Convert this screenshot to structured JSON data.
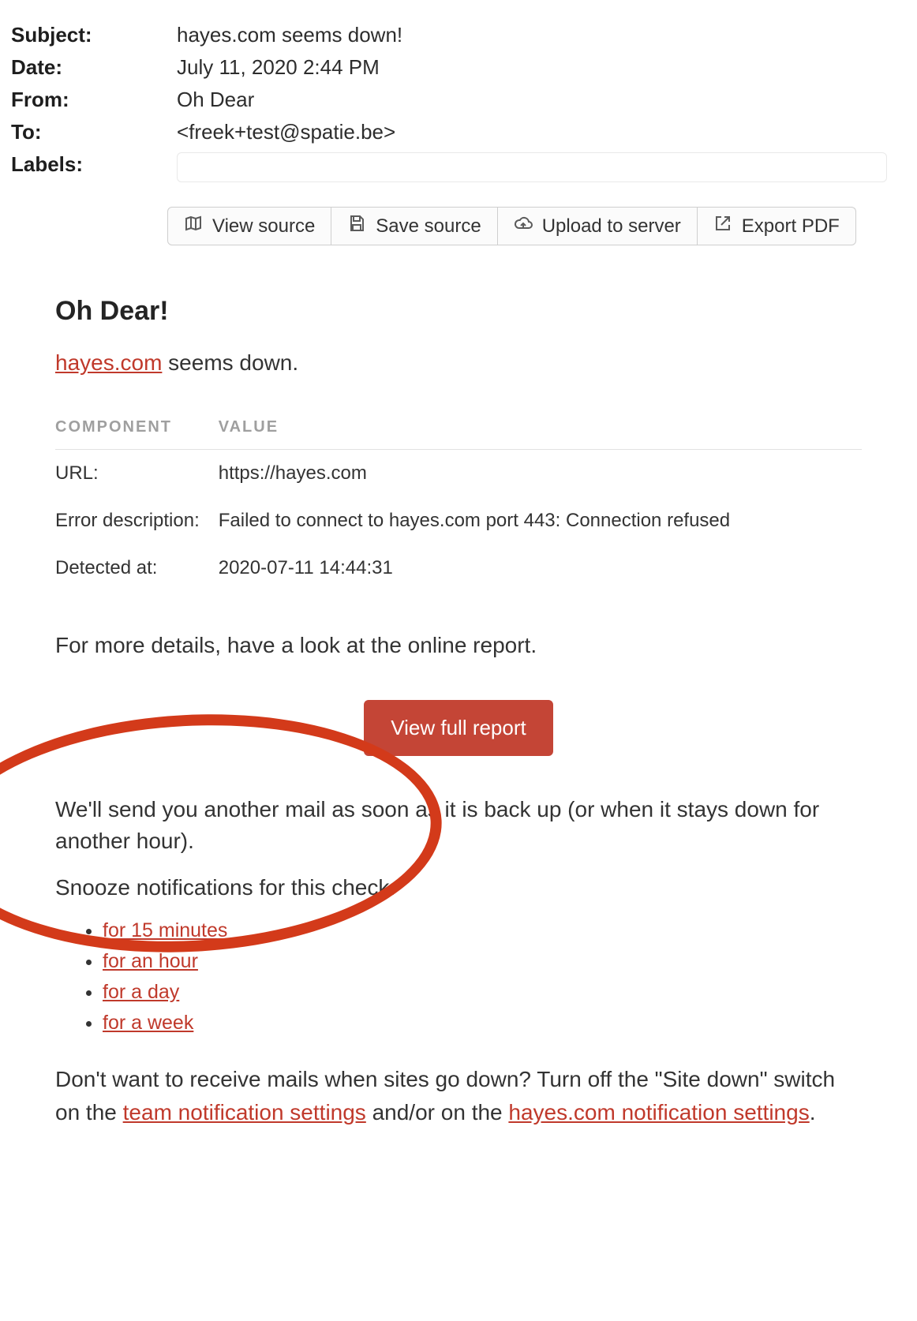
{
  "header": {
    "rows": {
      "subject": {
        "label": "Subject:",
        "value": "hayes.com seems down!"
      },
      "date": {
        "label": "Date:",
        "value": "July 11, 2020 2:44 PM"
      },
      "from": {
        "label": "From:",
        "value": "Oh Dear"
      },
      "to": {
        "label": "To:",
        "value": "<freek+test@spatie.be>"
      },
      "labels": {
        "label": "Labels:"
      }
    }
  },
  "toolbar": {
    "view_source": "View source",
    "save_source": "Save source",
    "upload": "Upload to server",
    "export_pdf": "Export PDF"
  },
  "email": {
    "title": "Oh Dear!",
    "lead_link": "hayes.com",
    "lead_rest": " seems down.",
    "thead_component": "COMPONENT",
    "thead_value": "VALUE",
    "rows": [
      {
        "key": "URL:",
        "val": "https://hayes.com"
      },
      {
        "key": "Error description:",
        "val": "Failed to connect to hayes.com port 443: Connection refused"
      },
      {
        "key": "Detected at:",
        "val": "2020-07-11 14:44:31"
      }
    ],
    "details_para": "For more details, have a look at the online report.",
    "cta": "View full report",
    "followup": "We'll send you another mail as soon as it is back up (or when it stays down for another hour).",
    "snooze_label": "Snooze notifications for this check:",
    "snooze_items": [
      "for 15 minutes",
      "for an hour",
      "for a day",
      "for a week"
    ],
    "footer_1": "Don't want to receive mails when sites go down? Turn off the \"Site down\" switch on the ",
    "footer_link1": "team notification settings",
    "footer_2": " and/or on the ",
    "footer_link2": "hayes.com notif­ication settings",
    "footer_3": "."
  }
}
